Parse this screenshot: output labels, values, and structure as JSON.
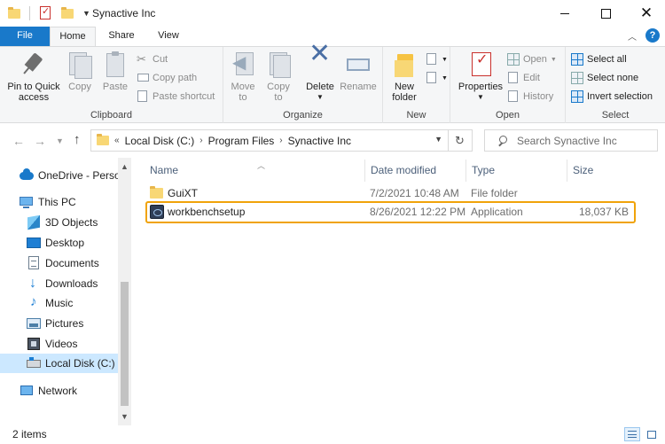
{
  "window": {
    "title": "Synactive Inc"
  },
  "ribbon_tabs": {
    "file": "File",
    "home": "Home",
    "share": "Share",
    "view": "View"
  },
  "ribbon": {
    "clipboard": {
      "label": "Clipboard",
      "pin_to_quick_access_line1": "Pin to Quick",
      "pin_to_quick_access_line2": "access",
      "copy": "Copy",
      "paste": "Paste",
      "cut": "Cut",
      "copy_path": "Copy path",
      "paste_shortcut": "Paste shortcut"
    },
    "organize": {
      "label": "Organize",
      "move_to_line1": "Move",
      "move_to_line2": "to",
      "copy_to_line1": "Copy",
      "copy_to_line2": "to",
      "delete": "Delete",
      "rename": "Rename"
    },
    "new": {
      "label": "New",
      "new_folder_line1": "New",
      "new_folder_line2": "folder"
    },
    "open": {
      "label": "Open",
      "properties": "Properties",
      "open": "Open",
      "edit": "Edit",
      "history": "History"
    },
    "select": {
      "label": "Select",
      "select_all": "Select all",
      "select_none": "Select none",
      "invert_selection": "Invert selection"
    }
  },
  "address": {
    "overflow": "«",
    "crumbs": [
      "Local Disk (C:)",
      "Program Files",
      "Synactive Inc"
    ],
    "separator": "›",
    "search_placeholder": "Search Synactive Inc"
  },
  "sidebar": {
    "items": [
      {
        "label": "OneDrive - Person",
        "icon": "onedrive-cloud-icon"
      },
      {
        "label": "This PC",
        "icon": "this-pc-icon"
      },
      {
        "label": "3D Objects",
        "icon": "3d-objects-icon"
      },
      {
        "label": "Desktop",
        "icon": "desktop-icon"
      },
      {
        "label": "Documents",
        "icon": "documents-icon"
      },
      {
        "label": "Downloads",
        "icon": "downloads-icon"
      },
      {
        "label": "Music",
        "icon": "music-icon"
      },
      {
        "label": "Pictures",
        "icon": "pictures-icon"
      },
      {
        "label": "Videos",
        "icon": "videos-icon"
      },
      {
        "label": "Local Disk (C:)",
        "icon": "local-disk-icon",
        "selected": true
      },
      {
        "label": "Network",
        "icon": "network-icon"
      }
    ]
  },
  "file_list": {
    "columns": {
      "name": "Name",
      "date_modified": "Date modified",
      "type": "Type",
      "size": "Size"
    },
    "rows": [
      {
        "name": "GuiXT",
        "date": "7/2/2021 10:48 AM",
        "type": "File folder",
        "size": "",
        "icon": "folder-icon"
      },
      {
        "name": "workbenchsetup",
        "date": "8/26/2021 12:22 PM",
        "type": "Application",
        "size": "18,037 KB",
        "icon": "application-icon",
        "highlighted": true
      }
    ]
  },
  "status": {
    "item_count": "2 items"
  },
  "colors": {
    "accent": "#1979ca",
    "highlight_border": "#f0a30a",
    "selected_bg": "#cce8ff"
  }
}
